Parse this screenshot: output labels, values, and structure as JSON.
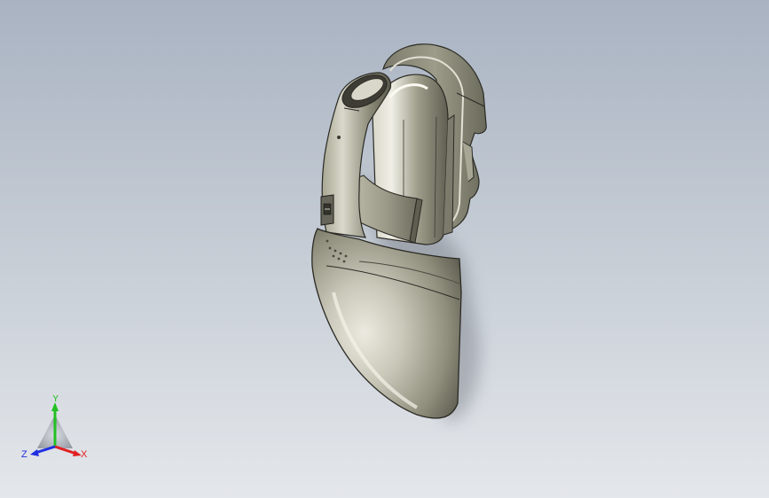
{
  "viewport": {
    "background_top": "#a9b3c2",
    "background_bottom": "#e4e7eb"
  },
  "model": {
    "body_color": "#8d8c7a",
    "highlight_color": "#e9e8de",
    "edge_color": "#2a2a24"
  },
  "triad": {
    "x_label": "X",
    "y_label": "Y",
    "z_label": "Z",
    "x_color": "#e02020",
    "y_color": "#22c022",
    "z_color": "#2030e0"
  }
}
